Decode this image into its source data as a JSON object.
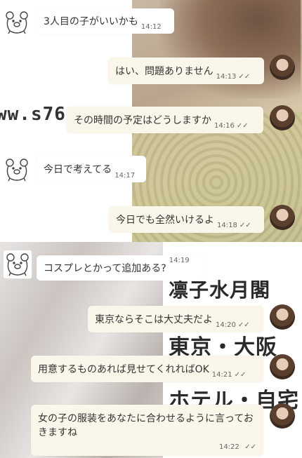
{
  "watermarks": [
    "ww.s76",
    "凛子水月閣",
    "東京・大阪",
    "ホテル・自宅"
  ],
  "messages": [
    {
      "side": "in",
      "text": "3人目の子がいいかも",
      "time": "14:12",
      "read": false
    },
    {
      "side": "out",
      "text": "はい、問題ありません",
      "time": "14:13",
      "read": true
    },
    {
      "side": "out",
      "text": "その時間の予定はどうしますか",
      "time": "14:16",
      "read": true
    },
    {
      "side": "in",
      "text": "今日で考えてる",
      "time": "14:17",
      "read": false
    },
    {
      "side": "out",
      "text": "今日でも全然いけるよ",
      "time": "14:18",
      "read": true
    },
    {
      "side": "in",
      "text": "コスプレとかって追加ある?",
      "time": "14:19",
      "read": false
    },
    {
      "side": "out",
      "text": "東京ならそこは大丈夫だよ",
      "time": "14:20",
      "read": true
    },
    {
      "side": "out",
      "text": "用意するものあれば見せてくれればOK",
      "time": "14:21",
      "read": true
    },
    {
      "side": "out",
      "text": "女の子の服装をあなたに合わせるように言っておきますね",
      "time": "14:22",
      "read": true
    }
  ],
  "icons": {
    "bear": "bear-icon",
    "read": "double-check-icon",
    "avatar": "profile-avatar"
  },
  "read_mark": "✓✓"
}
